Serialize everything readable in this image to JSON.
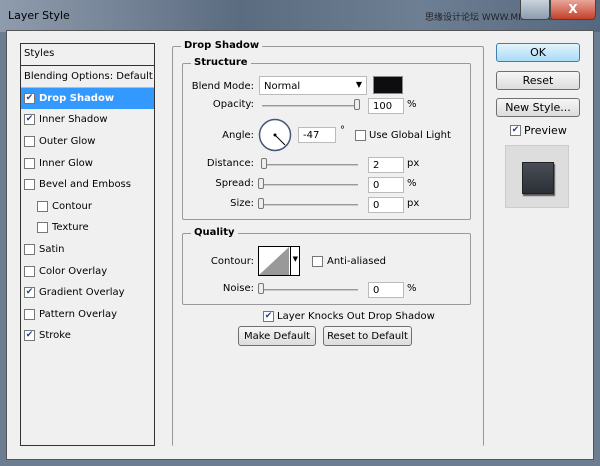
{
  "window": {
    "title": "Layer Style",
    "watermark": "思缘设计论坛 WWW.MISSYUAN.COM",
    "close": "X"
  },
  "sidebar": {
    "header": "Styles",
    "items": [
      {
        "label": "Blending Options: Default",
        "checkbox": false,
        "checked": false,
        "sub": false
      },
      {
        "label": "Drop Shadow",
        "checkbox": true,
        "checked": true,
        "sub": false,
        "selected": true
      },
      {
        "label": "Inner Shadow",
        "checkbox": true,
        "checked": true,
        "sub": false
      },
      {
        "label": "Outer Glow",
        "checkbox": true,
        "checked": false,
        "sub": false
      },
      {
        "label": "Inner Glow",
        "checkbox": true,
        "checked": false,
        "sub": false
      },
      {
        "label": "Bevel and Emboss",
        "checkbox": true,
        "checked": false,
        "sub": false
      },
      {
        "label": "Contour",
        "checkbox": true,
        "checked": false,
        "sub": true
      },
      {
        "label": "Texture",
        "checkbox": true,
        "checked": false,
        "sub": true
      },
      {
        "label": "Satin",
        "checkbox": true,
        "checked": false,
        "sub": false
      },
      {
        "label": "Color Overlay",
        "checkbox": true,
        "checked": false,
        "sub": false
      },
      {
        "label": "Gradient Overlay",
        "checkbox": true,
        "checked": true,
        "sub": false
      },
      {
        "label": "Pattern Overlay",
        "checkbox": true,
        "checked": false,
        "sub": false
      },
      {
        "label": "Stroke",
        "checkbox": true,
        "checked": true,
        "sub": false
      }
    ]
  },
  "panel": {
    "title": "Drop Shadow",
    "structure": {
      "title": "Structure",
      "blend_mode_label": "Blend Mode:",
      "blend_mode": "Normal",
      "color": "#0d0d0f",
      "opacity_label": "Opacity:",
      "opacity": "100",
      "opacity_unit": "%",
      "opacity_pct": 100,
      "angle_label": "Angle:",
      "angle": "-47",
      "angle_unit": "°",
      "global_light": "Use Global Light",
      "distance_label": "Distance:",
      "distance": "2",
      "distance_unit": "px",
      "spread_label": "Spread:",
      "spread": "0",
      "spread_unit": "%",
      "size_label": "Size:",
      "size": "0",
      "size_unit": "px"
    },
    "quality": {
      "title": "Quality",
      "contour_label": "Contour:",
      "anti_aliased": "Anti-aliased",
      "noise_label": "Noise:",
      "noise": "0",
      "noise_unit": "%"
    },
    "knockout": "Layer Knocks Out Drop Shadow",
    "make_default": "Make Default",
    "reset_default": "Reset to Default"
  },
  "buttons": {
    "ok": "OK",
    "reset": "Reset",
    "new_style": "New Style...",
    "preview": "Preview"
  }
}
